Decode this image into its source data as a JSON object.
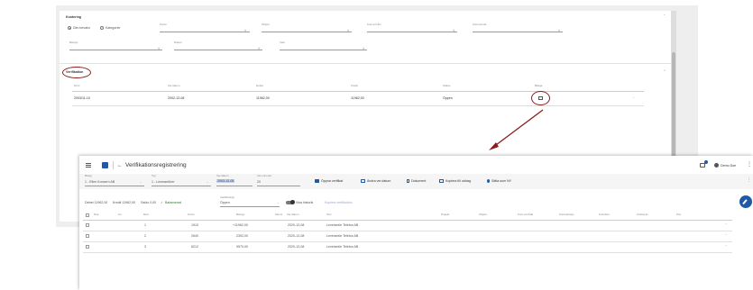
{
  "top": {
    "section1_title": "Kontering",
    "radio1": "Dim.bevakn",
    "radio2": "Kategorier",
    "fields_row1": [
      "Konto",
      "Objekt",
      "Kod arrt åtn",
      "Kommentar"
    ],
    "fields_row2": [
      "Belopp",
      "Datum",
      "Verk"
    ],
    "section2_title": "Verifikation",
    "table_headers": [
      "Nr/nr",
      "Ver.datum",
      "Debet",
      "Kredit",
      "Status",
      "Bilaga"
    ],
    "row": {
      "nr": "2003/11-10",
      "date": "2002-12-08",
      "debet": "11962,00",
      "kredit": "11962,00",
      "status": "Öppen"
    }
  },
  "window": {
    "title": "Verifikationsregistrering",
    "user": "Demo Doe",
    "company_label": "Bolag",
    "company_value": "1 - Ellen Koncern AB",
    "ledger_label": "Typ",
    "ledger_value": "1 - Leverantörer",
    "date_label": "Ver.datum",
    "date_value": "2003-12-05",
    "ver_label": "Ver.nummer",
    "ver_value": "20",
    "toolbar": [
      "Öppna verifikat",
      "Ändra ver.datum",
      "Dokument",
      "Kopiera till utdrag",
      "Sätta som NY"
    ],
    "summary": {
      "debet": "Debet 11962,00",
      "kredit": "Kredit 11962,00",
      "saldo": "Saldo 0,00",
      "balance": "Balanserad",
      "status_label": "Verifikatstyp",
      "status_value": "Öppen"
    },
    "toggle_label": "Visa historik",
    "copy_label": "Kopiera verifikation",
    "headers": [
      "Dok",
      "Ko.",
      "Rad",
      "Konto",
      "Belopp",
      "Moms",
      "Ver.datum",
      "Text",
      "Projekt",
      "Objekt",
      "Kunt.område",
      "Kontoanalys",
      "Kvantitet",
      "Ändrat av",
      "Pris"
    ],
    "rows": [
      {
        "rad": "1",
        "konto": "1910",
        "belopp": "+11962,00",
        "date": "2020-12-08",
        "text": "Leverantör Telefon AB"
      },
      {
        "rad": "2",
        "konto": "2640",
        "belopp": "2392,00",
        "date": "2020-12-08",
        "text": "Leverantör Telefon AB"
      },
      {
        "rad": "3",
        "konto": "6212",
        "belopp": "9570,00",
        "date": "2020-12-08",
        "text": "Leverantör Telefon AB"
      }
    ]
  },
  "colors": {
    "accent": "#1e5aa8",
    "annotation": "#8b1e1e",
    "toolbar_bg": "#f5f5f5",
    "chip": "#c8d2e6"
  }
}
